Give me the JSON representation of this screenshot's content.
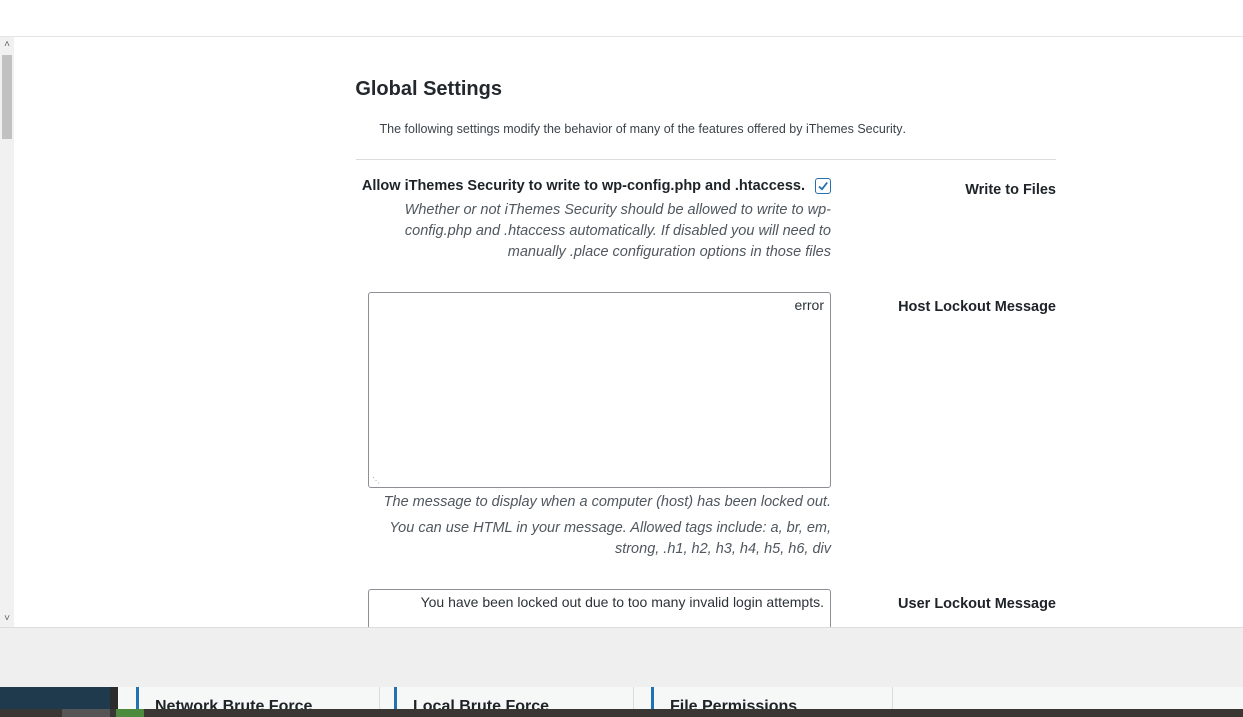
{
  "global_settings": {
    "title": "Global Settings",
    "description": ".The following settings modify the behavior of many of the features offered by iThemes Security"
  },
  "write_to_files": {
    "label": "Write to Files",
    "checkbox_text": ".Allow iThemes Security to write to wp-config.php and .htaccess",
    "checked": true,
    "description": "Whether or not iThemes Security should be allowed to write to wp-config.php and .htaccess automatically. If disabled you will need to manually .place configuration options in those files"
  },
  "host_lockout": {
    "label": "Host Lockout Message",
    "value": "error",
    "description": ".The message to display when a computer (host) has been locked out",
    "html_note": "You can use HTML in your message. Allowed tags include: a, br, em, strong, .h1, h2, h3, h4, h5, h6, div"
  },
  "user_lockout": {
    "label": "User Lockout Message",
    "value": ".You have been locked out due to too many invalid login attempts"
  },
  "bottom_cards": [
    {
      "title": "Network Brute Force"
    },
    {
      "title": "Local Brute Force"
    },
    {
      "title": "File Permissions"
    }
  ],
  "icons": {
    "scroll_up": "chevron-up-icon",
    "scroll_down": "chevron-down-icon",
    "checkmark": "checkmark-icon"
  },
  "colors": {
    "accent": "#2271b1",
    "heading": "#23282d",
    "muted": "#50575e"
  }
}
